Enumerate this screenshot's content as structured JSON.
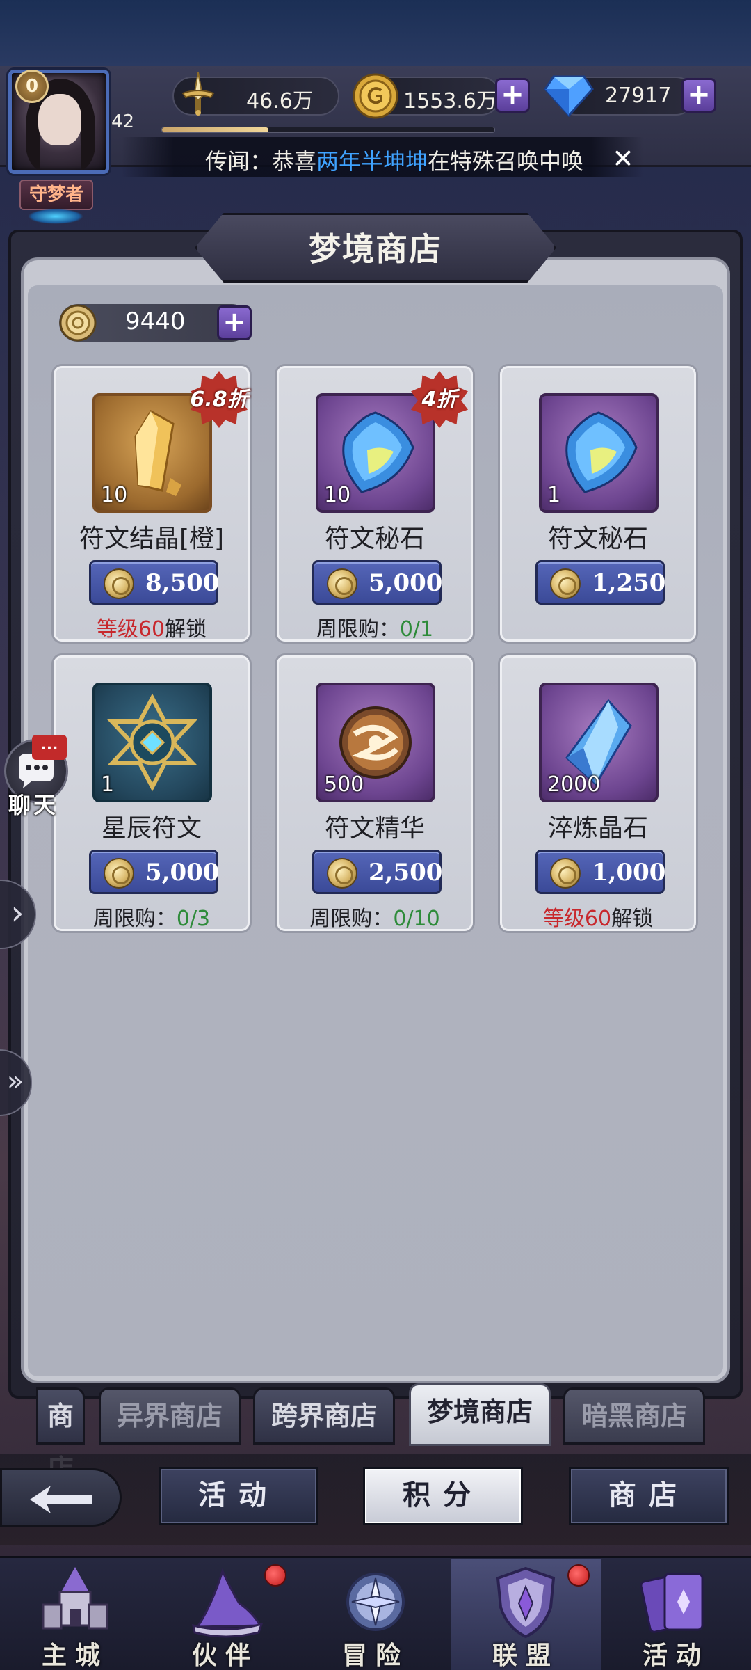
{
  "player": {
    "vip": "0",
    "level": "42",
    "title": "守梦者",
    "exp_fraction": 0.32
  },
  "resources": {
    "power": "46.6万",
    "gold": "1553.6万",
    "diamond": "27917"
  },
  "news": {
    "prefix": "传闻：恭喜",
    "highlight": "两年半坤坤",
    "suffix": "在特殊召唤中唤"
  },
  "shop": {
    "title": "梦境商店",
    "currency": "9440",
    "items": [
      {
        "name": "符文结晶[橙]",
        "qty": "10",
        "price": "8,500",
        "discount": "6.8折",
        "limit_label": "等级60",
        "limit_suffix": "解锁",
        "limit_type": "lock",
        "icon": "rune-crystal-orange-icon"
      },
      {
        "name": "符文秘石",
        "qty": "10",
        "price": "5,000",
        "discount": "4折",
        "limit_label": "周限购：",
        "limit_value": "0/1",
        "limit_type": "weekly",
        "icon": "rune-secret-stone-icon"
      },
      {
        "name": "符文秘石",
        "qty": "1",
        "price": "1,250",
        "icon": "rune-secret-stone-icon"
      },
      {
        "name": "星辰符文",
        "qty": "1",
        "price": "5,000",
        "limit_label": "周限购：",
        "limit_value": "0/3",
        "limit_type": "weekly",
        "icon": "star-rune-icon"
      },
      {
        "name": "符文精华",
        "qty": "500",
        "price": "2,500",
        "limit_label": "周限购：",
        "limit_value": "0/10",
        "limit_type": "weekly",
        "icon": "rune-essence-icon"
      },
      {
        "name": "淬炼晶石",
        "qty": "2000",
        "price": "1,000",
        "limit_label": "等级60",
        "limit_suffix": "解锁",
        "limit_type": "lock",
        "icon": "refine-crystal-icon"
      }
    ]
  },
  "chat": {
    "label": "聊天",
    "bubble": "..."
  },
  "tabs": [
    {
      "label": "商店",
      "state": "partial"
    },
    {
      "label": "异界商店",
      "state": "dim"
    },
    {
      "label": "跨界商店",
      "state": "normal"
    },
    {
      "label": "梦境商店",
      "state": "active"
    },
    {
      "label": "暗黑商店",
      "state": "dim"
    }
  ],
  "subnav": [
    {
      "label": "活动"
    },
    {
      "label": "积分",
      "active": true
    },
    {
      "label": "商店"
    }
  ],
  "bottom_nav": [
    {
      "label": "主城",
      "icon": "castle-icon"
    },
    {
      "label": "伙伴",
      "icon": "wizard-hat-icon",
      "badge": true
    },
    {
      "label": "冒险",
      "icon": "compass-icon"
    },
    {
      "label": "联盟",
      "icon": "shield-icon",
      "badge": true,
      "active": true
    },
    {
      "label": "活动",
      "icon": "cards-icon"
    }
  ],
  "colors": {
    "price_button": "#3b4a98",
    "limit_green": "#2e8b3a",
    "limit_red": "#c8282d",
    "discount_badge": "#b8322a",
    "news_highlight": "#3fa3ff"
  }
}
